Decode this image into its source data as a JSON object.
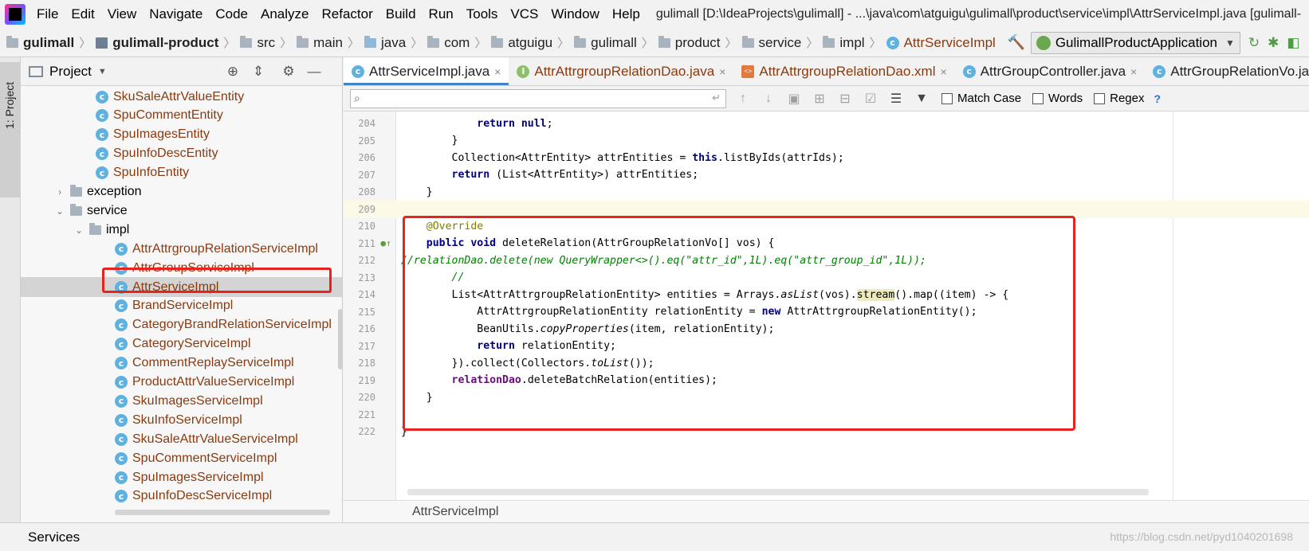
{
  "menu": {
    "items": [
      "File",
      "Edit",
      "View",
      "Navigate",
      "Code",
      "Analyze",
      "Refactor",
      "Build",
      "Run",
      "Tools",
      "VCS",
      "Window",
      "Help"
    ],
    "window_title": "gulimall [D:\\IdeaProjects\\gulimall] - ...\\java\\com\\atguigu\\gulimall\\product\\service\\impl\\AttrServiceImpl.java [gulimall-"
  },
  "nav": {
    "crumbs": [
      "gulimall",
      "gulimall-product",
      "src",
      "main",
      "java",
      "com",
      "atguigu",
      "gulimall",
      "product",
      "service",
      "impl",
      "AttrServiceImpl"
    ],
    "run_config": "GulimallProductApplication"
  },
  "project": {
    "title": "Project",
    "side_label": "1: Project",
    "tree": [
      {
        "label": "SkuSaleAttrValueEntity",
        "kind": "class"
      },
      {
        "label": "SpuCommentEntity",
        "kind": "class"
      },
      {
        "label": "SpuImagesEntity",
        "kind": "class"
      },
      {
        "label": "SpuInfoDescEntity",
        "kind": "class"
      },
      {
        "label": "SpuInfoEntity",
        "kind": "class"
      },
      {
        "label": "exception",
        "kind": "folder-collapsed"
      },
      {
        "label": "service",
        "kind": "folder-open"
      },
      {
        "label": "impl",
        "kind": "folder-open"
      },
      {
        "label": "AttrAttrgroupRelationServiceImpl",
        "kind": "class"
      },
      {
        "label": "AttrGroupServiceImpl",
        "kind": "class"
      },
      {
        "label": "AttrServiceImpl",
        "kind": "class",
        "selected": true
      },
      {
        "label": "BrandServiceImpl",
        "kind": "class"
      },
      {
        "label": "CategoryBrandRelationServiceImpl",
        "kind": "class"
      },
      {
        "label": "CategoryServiceImpl",
        "kind": "class"
      },
      {
        "label": "CommentReplayServiceImpl",
        "kind": "class"
      },
      {
        "label": "ProductAttrValueServiceImpl",
        "kind": "class"
      },
      {
        "label": "SkuImagesServiceImpl",
        "kind": "class"
      },
      {
        "label": "SkuInfoServiceImpl",
        "kind": "class"
      },
      {
        "label": "SkuSaleAttrValueServiceImpl",
        "kind": "class"
      },
      {
        "label": "SpuCommentServiceImpl",
        "kind": "class"
      },
      {
        "label": "SpuImagesServiceImpl",
        "kind": "class"
      },
      {
        "label": "SpuInfoDescServiceImpl",
        "kind": "class"
      }
    ]
  },
  "tabs": [
    {
      "label": "AttrServiceImpl.java",
      "icon": "c",
      "active": true
    },
    {
      "label": "AttrAttrgroupRelationDao.java",
      "icon": "i"
    },
    {
      "label": "AttrAttrgroupRelationDao.xml",
      "icon": "xml"
    },
    {
      "label": "AttrGroupController.java",
      "icon": "c"
    },
    {
      "label": "AttrGroupRelationVo.ja",
      "icon": "c"
    }
  ],
  "find": {
    "placeholder": "",
    "match_case": "Match Case",
    "words": "Words",
    "regex": "Regex",
    "help": "?"
  },
  "code": {
    "lines": [
      {
        "n": "204",
        "html": "            <span class=\"kw\">return null</span>;"
      },
      {
        "n": "205",
        "html": "        }"
      },
      {
        "n": "206",
        "html": "        Collection&lt;AttrEntity&gt; attrEntities = <span class=\"kw\">this</span>.listByIds(attrIds);"
      },
      {
        "n": "207",
        "html": "        <span class=\"kw\">return</span> (List&lt;AttrEntity&gt;) attrEntities;"
      },
      {
        "n": "208",
        "html": "    }"
      },
      {
        "n": "209",
        "html": "",
        "current": true
      },
      {
        "n": "210",
        "html": "    <span class=\"ann\">@Override</span>"
      },
      {
        "n": "211",
        "html": "    <span class=\"kw\">public void</span> deleteRelation(AttrGroupRelationVo[] vos) {"
      },
      {
        "n": "212",
        "html": "<span class=\"cmtg\">//relationDao.delete(new QueryWrapper&lt;&gt;().eq(\"attr_id\",1L).eq(\"attr_group_id\",1L));</span>"
      },
      {
        "n": "213",
        "html": "        <span class=\"cmtg\">//</span>"
      },
      {
        "n": "214",
        "html": "        List&lt;AttrAttrgroupRelationEntity&gt; entities = Arrays.<span class=\"it\">asList</span>(vos).<span class=\"hl\">stream</span>().map((item) -&gt; {"
      },
      {
        "n": "215",
        "html": "            AttrAttrgroupRelationEntity relationEntity = <span class=\"kw\">new</span> AttrAttrgroupRelationEntity();"
      },
      {
        "n": "216",
        "html": "            BeanUtils.<span class=\"it\">copyProperties</span>(item, relationEntity);"
      },
      {
        "n": "217",
        "html": "            <span class=\"kw\">return</span> relationEntity;"
      },
      {
        "n": "218",
        "html": "        }).collect(Collectors.<span class=\"it\">toList</span>());"
      },
      {
        "n": "219",
        "html": "        <span class=\"fld\">relationDao</span>.deleteBatchRelation(entities);"
      },
      {
        "n": "220",
        "html": "    }"
      },
      {
        "n": "221",
        "html": ""
      },
      {
        "n": "222",
        "html": "}"
      }
    ],
    "footer_breadcrumb": "AttrServiceImpl"
  },
  "bottom": {
    "services": "Services",
    "watermark": "https://blog.csdn.net/pyd1040201698"
  },
  "colors": {
    "highlight_box": "#e8221d",
    "tab_underline": "#4083c9",
    "class_text": "#8a3a0f"
  }
}
